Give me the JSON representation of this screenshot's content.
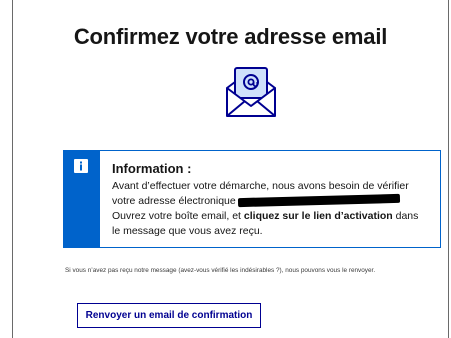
{
  "page": {
    "title": "Confirmez votre adresse email"
  },
  "icons": {
    "envelope": "envelope-at-icon",
    "info": "info-icon"
  },
  "colors": {
    "accent_blue": "#0063cb",
    "button_blue": "#000091",
    "text": "#161616"
  },
  "info_box": {
    "title": "Information :",
    "line1": "Avant d’effectuer votre démarche, nous avons besoin de vérifier",
    "line2_prefix": "votre adresse électronique",
    "line3_prefix": "Ouvrez votre boîte email, et ",
    "line3_bold": "cliquez sur le lien d’activation",
    "line3_suffix": " dans",
    "line4": "le message que vous avez reçu."
  },
  "note": {
    "text": "Si vous n’avez pas reçu notre message (avez-vous vérifié les indésirables ?), nous pouvons vous le renvoyer."
  },
  "actions": {
    "resend_label": "Renvoyer un email de confirmation"
  }
}
